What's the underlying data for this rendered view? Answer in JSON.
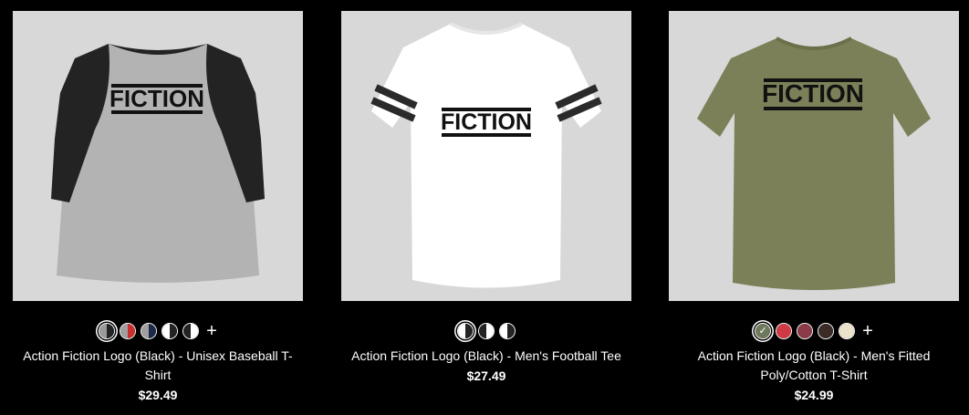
{
  "products": [
    {
      "title": "Action Fiction Logo (Black) - Unisex Baseball T-Shirt",
      "price": "$29.49",
      "logo_text": "FICTION",
      "shirt_color": "#b3b3b3",
      "sleeve_color": "#232323",
      "swatches": [
        {
          "left": "#9a9a9a",
          "right": "#232323",
          "selected": true
        },
        {
          "left": "#a0a0a0",
          "right": "#c8302f",
          "selected": false
        },
        {
          "left": "#a0a0a0",
          "right": "#1e2a4a",
          "selected": false
        },
        {
          "left": "#ffffff",
          "right": "#232323",
          "selected": false
        },
        {
          "left": "#232323",
          "right": "#ffffff",
          "selected": false
        }
      ]
    },
    {
      "title": "Action Fiction Logo (Black) - Men's Football Tee",
      "price": "$27.49",
      "logo_text": "FICTION",
      "shirt_color": "#ffffff",
      "stripe_color": "#2a2a2a",
      "swatches": [
        {
          "left": "#ffffff",
          "right": "#232323",
          "selected": true
        },
        {
          "left": "#232323",
          "right": "#ffffff",
          "selected": false
        },
        {
          "left": "#ffffff",
          "right": "#232323",
          "selected": false
        }
      ]
    },
    {
      "title": "Action Fiction Logo (Black) - Men's Fitted Poly/Cotton T-Shirt",
      "price": "$24.99",
      "logo_text": "FICTION",
      "shirt_color": "#7b8058",
      "swatches": [
        {
          "left": "#6f7a5c",
          "right": "#6f7a5c",
          "selected": true
        },
        {
          "left": "#d03a44",
          "right": "#d03a44",
          "selected": false
        },
        {
          "left": "#8a3a48",
          "right": "#8a3a48",
          "selected": false
        },
        {
          "left": "#3b2b26",
          "right": "#3b2b26",
          "selected": false
        },
        {
          "left": "#ebe2cc",
          "right": "#ebe2cc",
          "selected": false
        }
      ]
    }
  ],
  "more_colors_symbol": "+",
  "selected_check_symbol": "✓",
  "background_color": "#000000",
  "image_bg_color": "#d8d8d8"
}
